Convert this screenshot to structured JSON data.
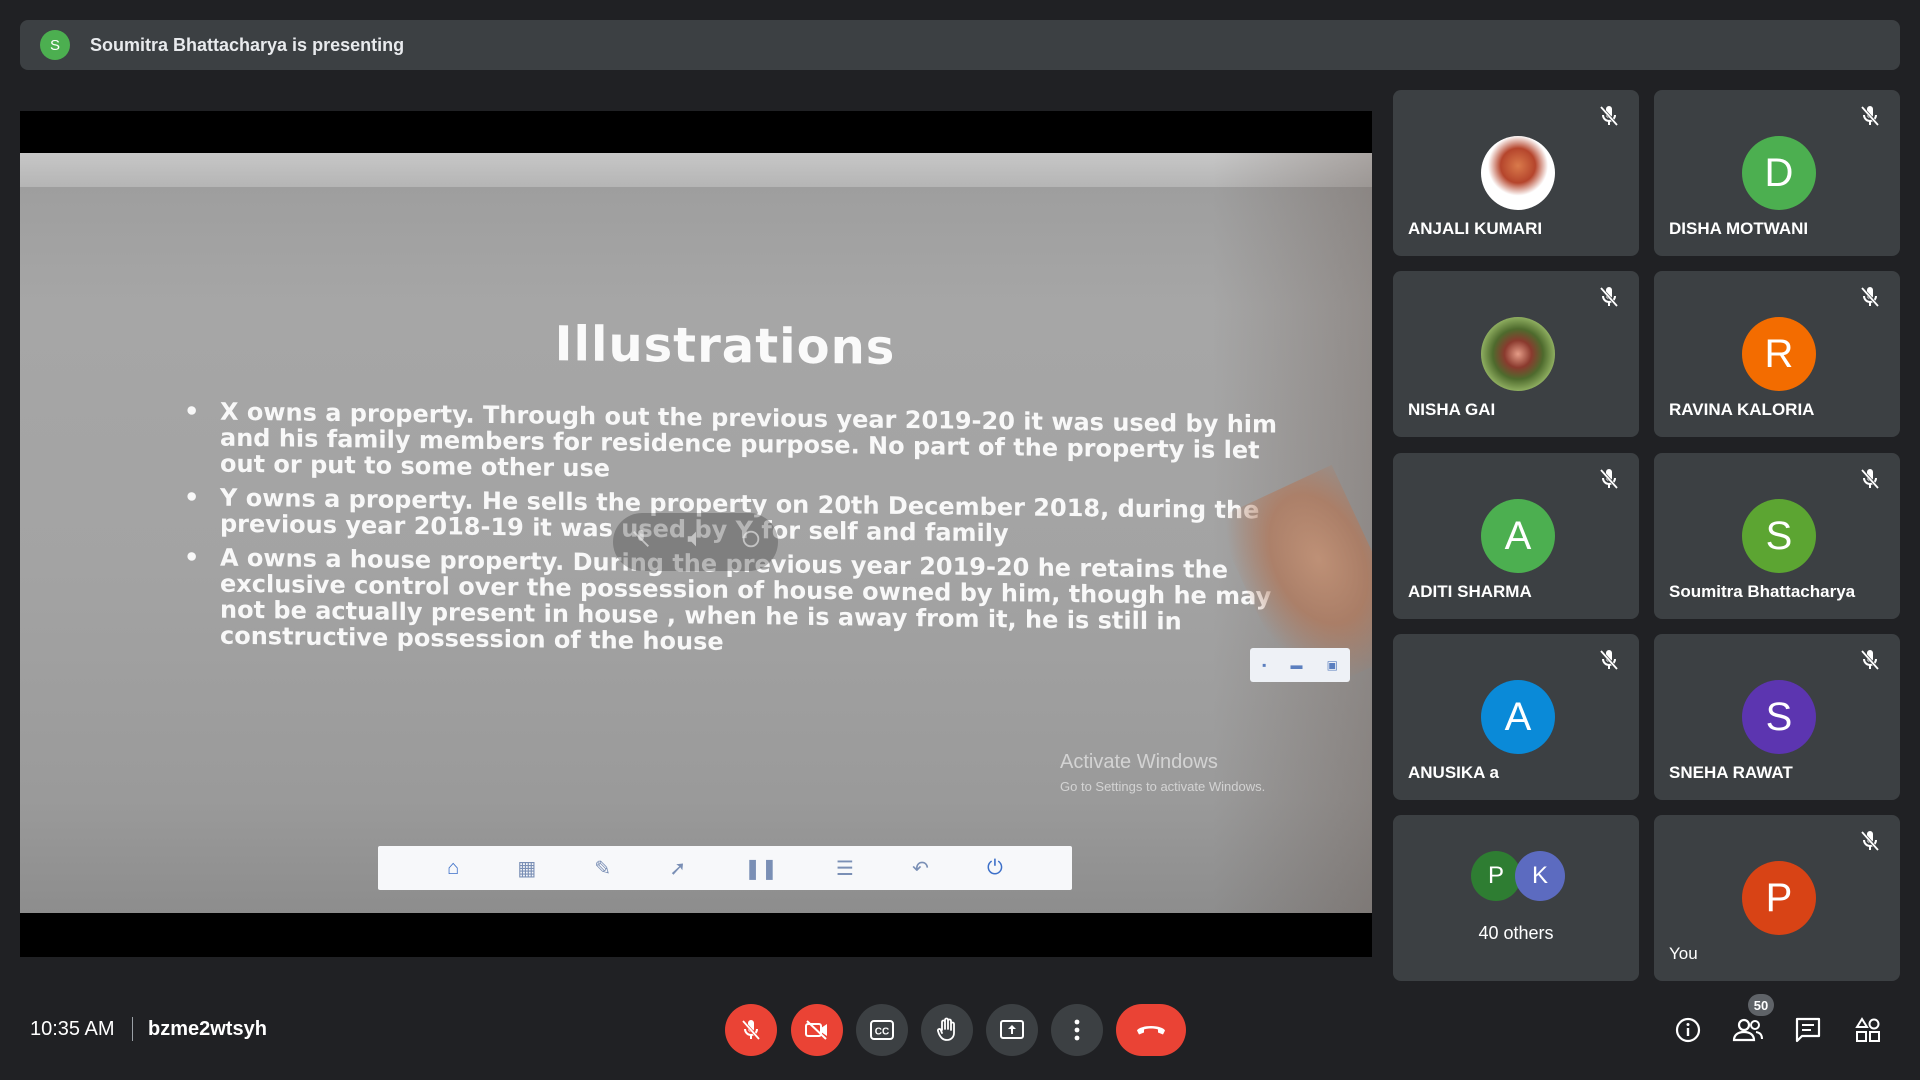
{
  "banner": {
    "avatar_letter": "S",
    "text": "Soumitra Bhattacharya is presenting"
  },
  "slide": {
    "title": "Illustrations",
    "bullets": [
      "X owns a property. Through out the previous year 2019-20 it was used by him and his family members  for residence purpose. No part of the property is let out or put to some other use",
      "Y owns a property. He sells the property on 20th December 2018, during the previous year 2018-19 it was used by Y for self and family",
      "A owns a house property. During the previous year 2019-20 he retains the exclusive control over the possession of house owned by him, though he may not be actually present in house , when he is away from it, he is still in constructive possession of the house"
    ],
    "watermark_line1": "Activate Windows",
    "watermark_line2": "Go to Settings to activate Windows."
  },
  "participants": [
    {
      "name": "ANJALI KUMARI",
      "initial": "",
      "color": "",
      "photo": "anjali",
      "muted": true
    },
    {
      "name": "DISHA MOTWANI",
      "initial": "D",
      "color": "#4caf50",
      "photo": "",
      "muted": true
    },
    {
      "name": "NISHA GAI",
      "initial": "",
      "color": "",
      "photo": "nisha",
      "muted": true
    },
    {
      "name": "RAVINA KALORIA",
      "initial": "R",
      "color": "#f36c00",
      "photo": "",
      "muted": true
    },
    {
      "name": "ADITI SHARMA",
      "initial": "A",
      "color": "#4caf50",
      "photo": "",
      "muted": true
    },
    {
      "name": "Soumitra Bhattacharya",
      "initial": "S",
      "color": "#5ca532",
      "photo": "",
      "muted": true
    },
    {
      "name": "ANUSIKA a",
      "initial": "A",
      "color": "#0a8ad8",
      "photo": "",
      "muted": true
    },
    {
      "name": "SNEHA RAWAT",
      "initial": "S",
      "color": "#5c35b0",
      "photo": "",
      "muted": true
    }
  ],
  "others_tile": {
    "avatar1": "P",
    "avatar1_color": "#2e7d32",
    "avatar2": "K",
    "avatar2_color": "#5c6bc0",
    "label": "40 others"
  },
  "self_tile": {
    "name": "You",
    "initial": "P",
    "color": "#d84315",
    "muted": true
  },
  "bottom_bar": {
    "time": "10:35 AM",
    "meeting_code": "bzme2wtsyh",
    "participant_count": "50"
  },
  "controls": {
    "mic_icon": "mic-off-icon",
    "camera_icon": "camera-off-icon",
    "captions_icon": "captions-icon",
    "hand_icon": "raise-hand-icon",
    "present_icon": "present-icon",
    "more_icon": "more-options-icon",
    "end_icon": "end-call-icon"
  }
}
